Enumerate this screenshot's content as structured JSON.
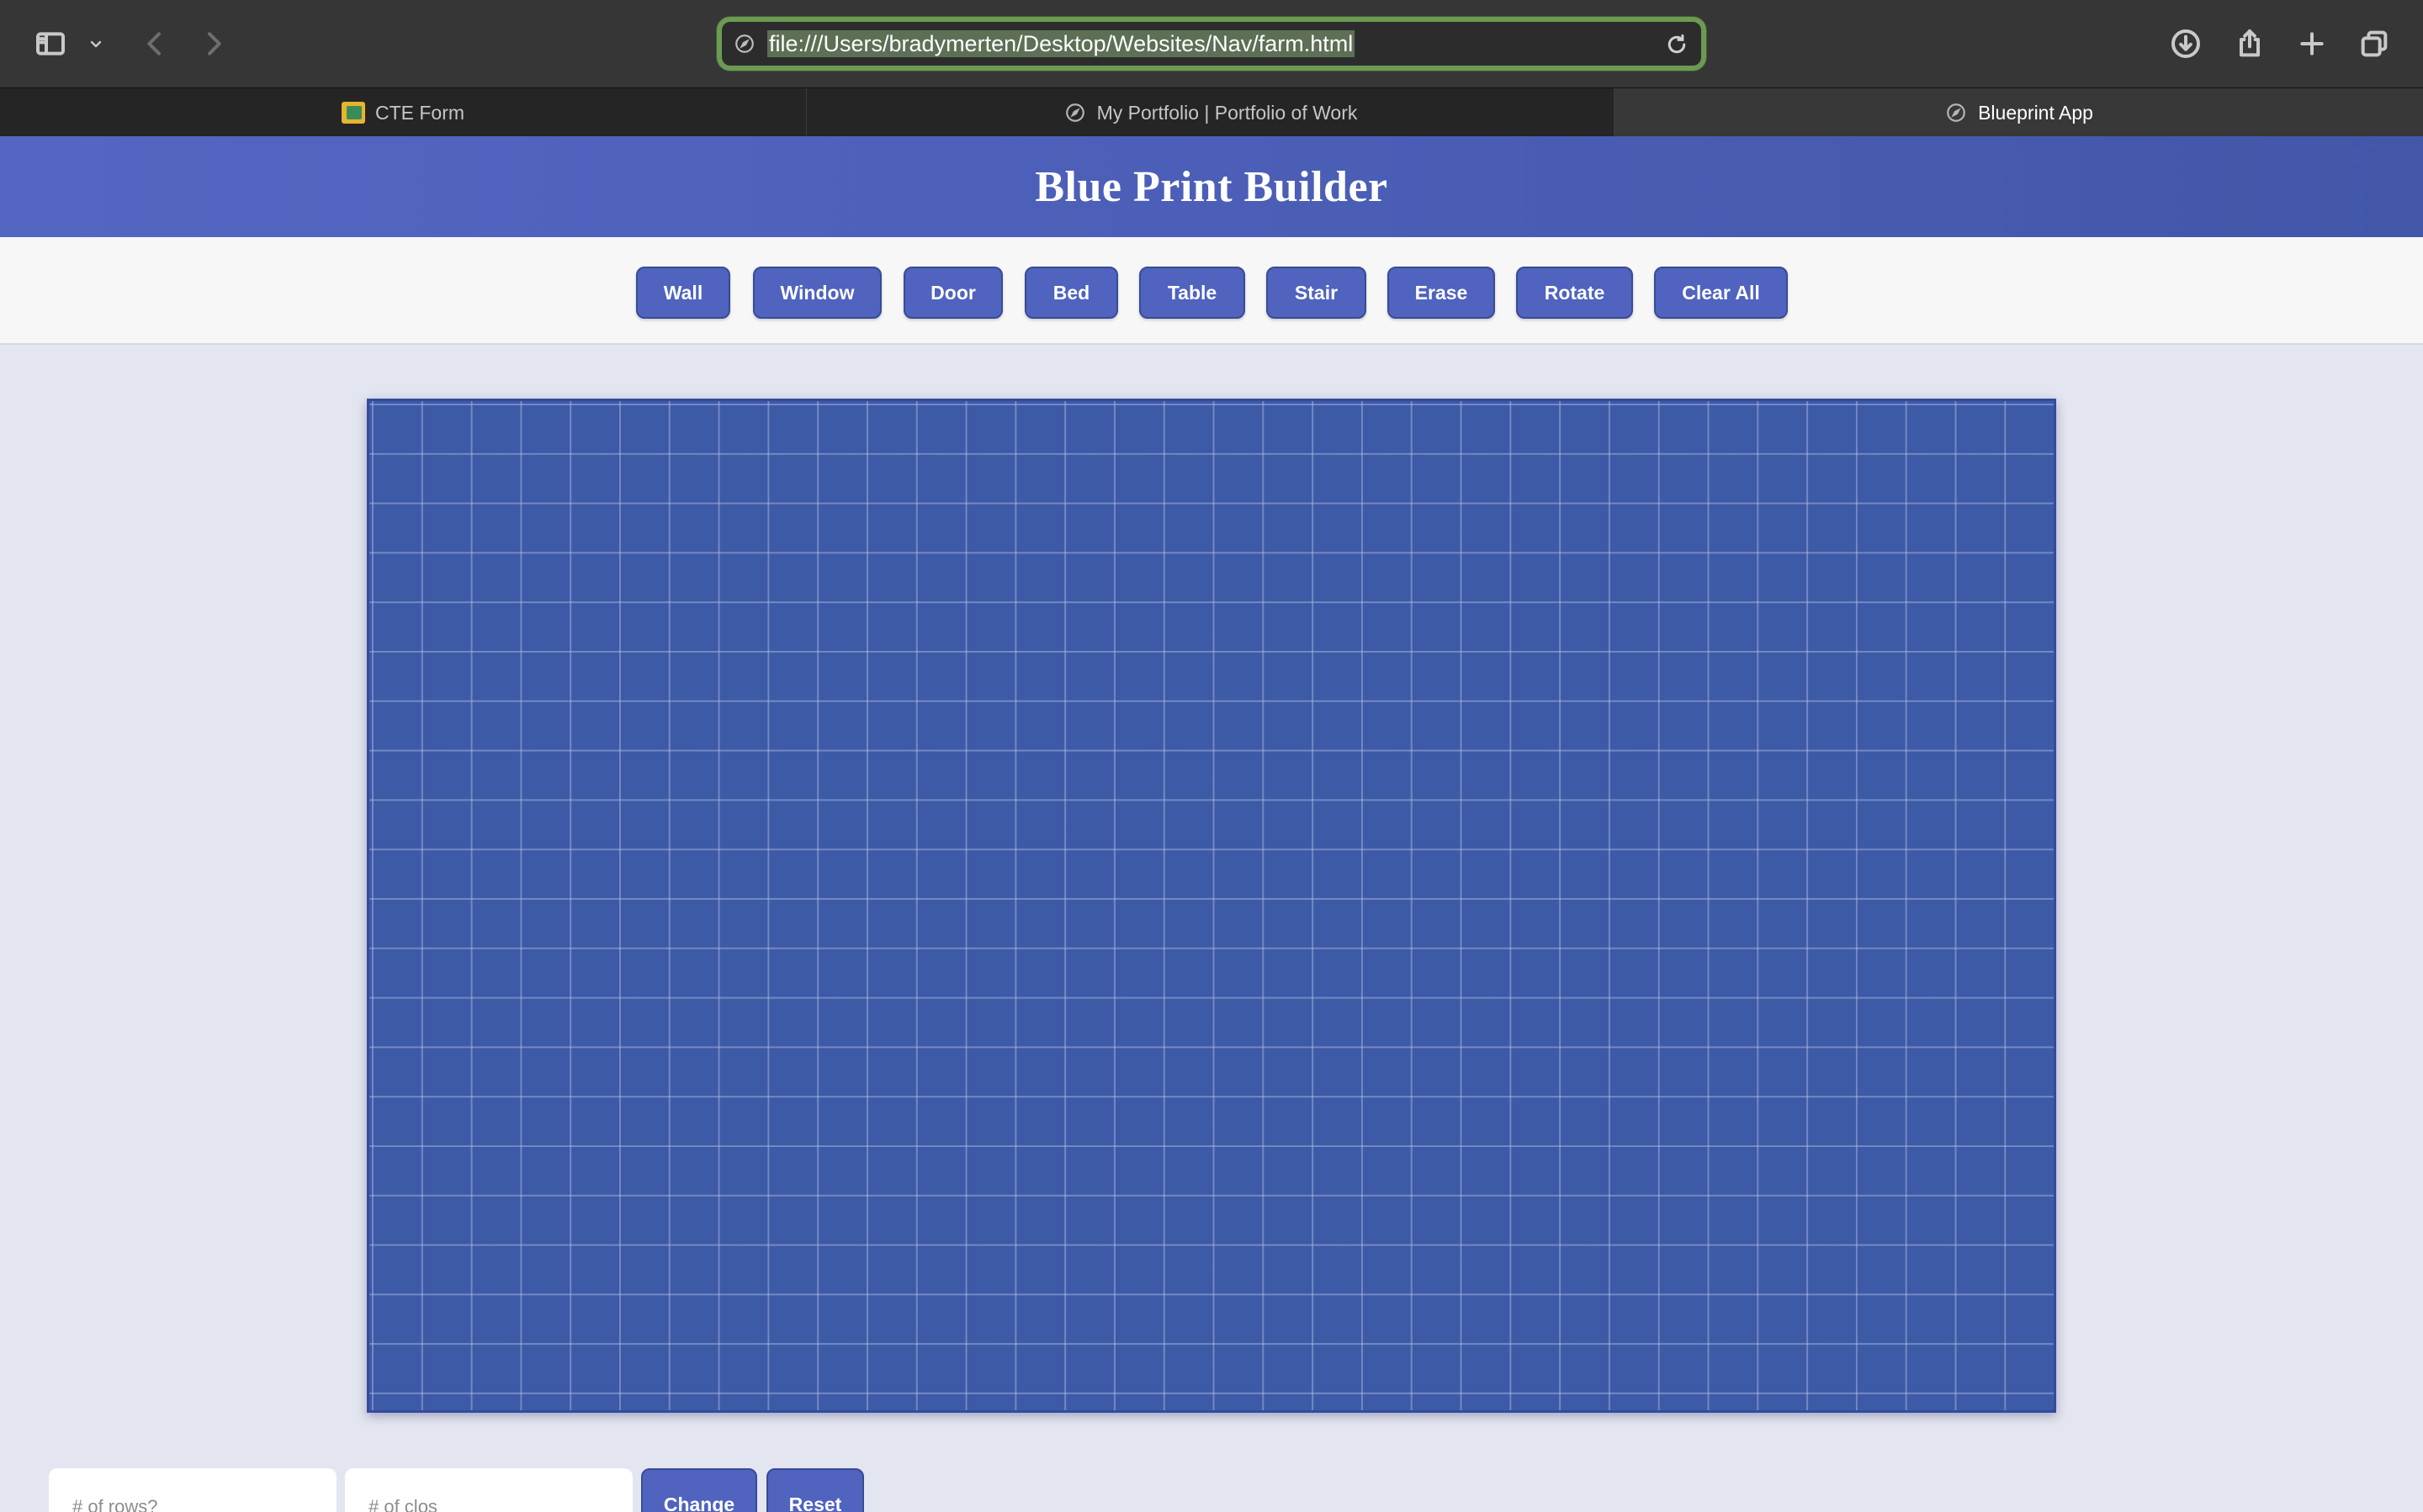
{
  "browser": {
    "url": "file:///Users/bradymerten/Desktop/Websites/Nav/farm.html",
    "tabs": [
      {
        "label": "CTE Form",
        "icon": "image-favicon-icon",
        "active": false
      },
      {
        "label": "My Portfolio | Portfolio of Work",
        "icon": "compass-icon",
        "active": false
      },
      {
        "label": "Blueprint App",
        "icon": "compass-icon",
        "active": true
      }
    ],
    "toolbar_icons": [
      "sidebar-icon",
      "chevron-down-icon",
      "back-icon",
      "forward-icon",
      "reload-icon",
      "download-icon",
      "share-icon",
      "new-tab-icon",
      "tab-overview-icon"
    ]
  },
  "app": {
    "title": "Blue Print Builder",
    "tools": [
      "Wall",
      "Window",
      "Door",
      "Bed",
      "Table",
      "Stair",
      "Erase",
      "Rotate",
      "Clear All"
    ],
    "grid": {
      "columns": 34,
      "rows": 20
    },
    "rows_placeholder": "# of rows?",
    "cols_placeholder": "# of clos",
    "change_label": "Change",
    "reset_label": "Reset"
  },
  "colors": {
    "accent": "#4f63bf",
    "header": "#4a5db5",
    "grid_background": "#3d5aa6",
    "url_focus_ring": "#6c9a54"
  }
}
